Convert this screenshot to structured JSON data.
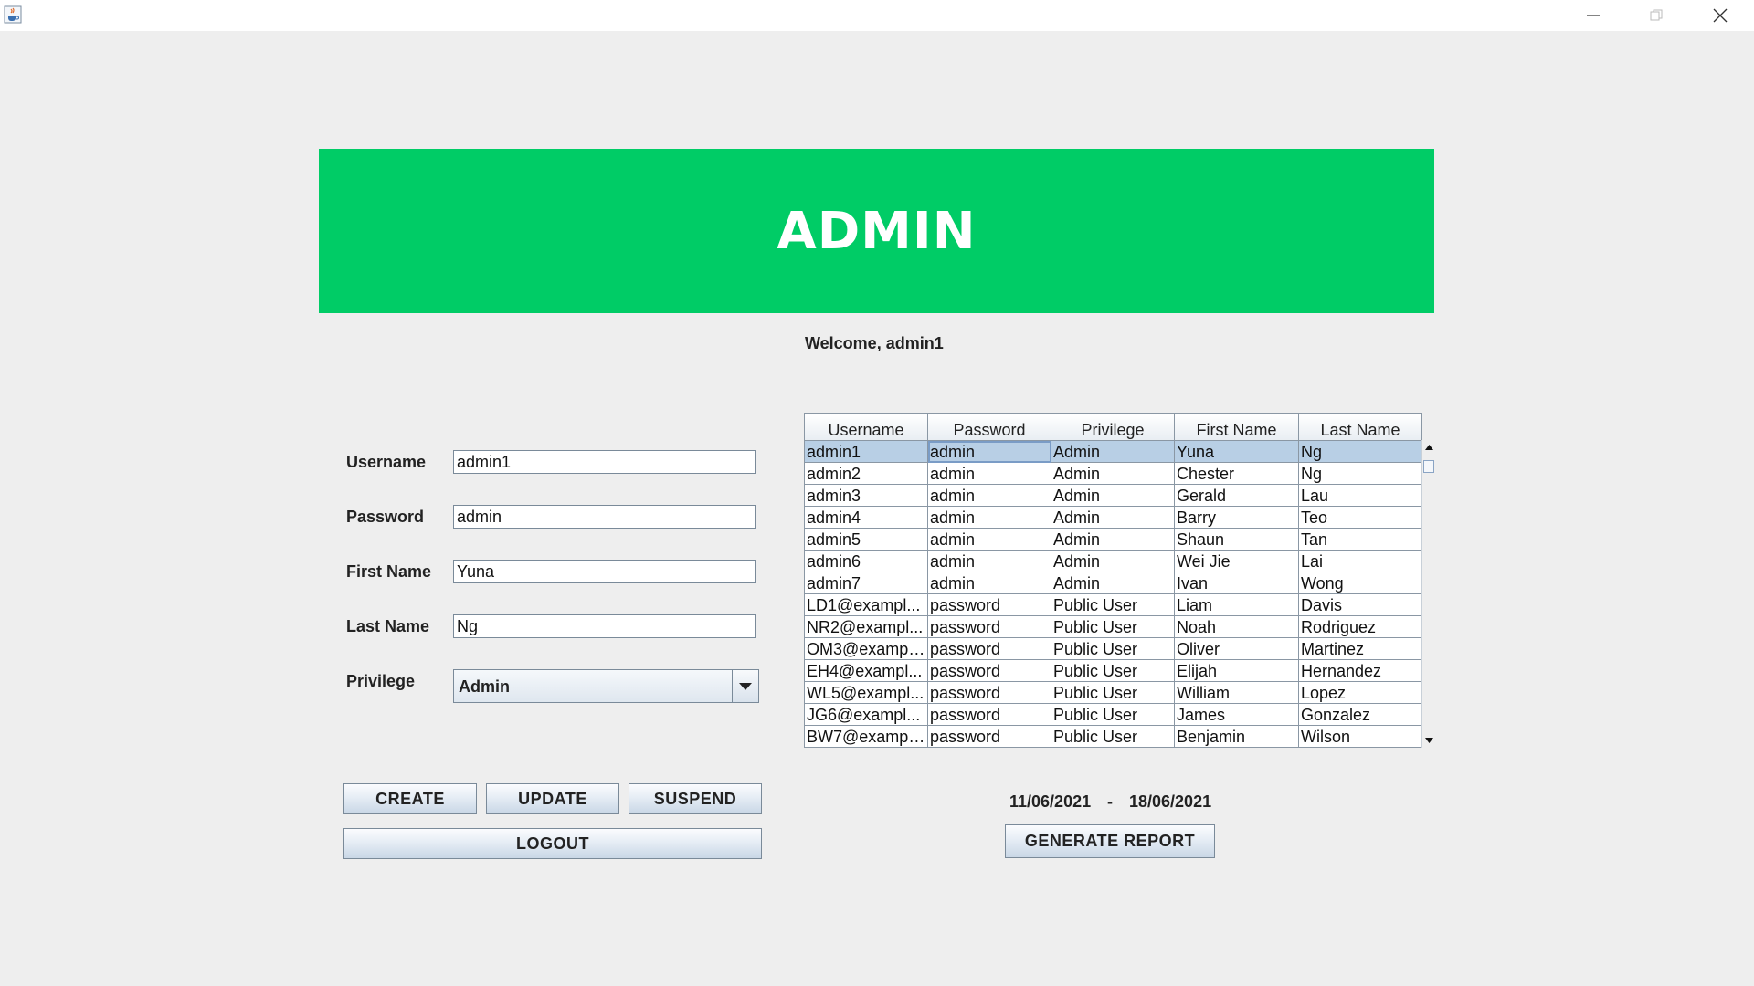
{
  "window": {
    "icon": "java-cup-icon",
    "controls": [
      "minimize-icon",
      "restore-icon",
      "close-icon"
    ]
  },
  "header": {
    "title": "ADMIN",
    "background": "#00cc66"
  },
  "welcome": "Welcome, admin1",
  "form": {
    "username_label": "Username",
    "username_value": "admin1",
    "password_label": "Password",
    "password_value": "admin",
    "first_name_label": "First Name",
    "first_name_value": "Yuna",
    "last_name_label": "Last Name",
    "last_name_value": "Ng",
    "privilege_label": "Privilege",
    "privilege_value": "Admin"
  },
  "buttons": {
    "create": "CREATE",
    "update": "UPDATE",
    "suspend": "SUSPEND",
    "logout": "LOGOUT",
    "generate_report": "GENERATE REPORT"
  },
  "table": {
    "columns": [
      "Username",
      "Password",
      "Privilege",
      "First Name",
      "Last Name"
    ],
    "rows": [
      [
        "admin1",
        "admin",
        "Admin",
        "Yuna",
        "Ng"
      ],
      [
        "admin2",
        "admin",
        "Admin",
        "Chester",
        "Ng"
      ],
      [
        "admin3",
        "admin",
        "Admin",
        "Gerald",
        "Lau"
      ],
      [
        "admin4",
        "admin",
        "Admin",
        "Barry",
        "Teo"
      ],
      [
        "admin5",
        "admin",
        "Admin",
        "Shaun",
        "Tan"
      ],
      [
        "admin6",
        "admin",
        "Admin",
        "Wei Jie",
        "Lai"
      ],
      [
        "admin7",
        "admin",
        "Admin",
        "Ivan",
        "Wong"
      ],
      [
        "LD1@exampl...",
        "password",
        "Public User",
        "Liam",
        "Davis"
      ],
      [
        "NR2@exampl...",
        "password",
        "Public User",
        "Noah",
        "Rodriguez"
      ],
      [
        "OM3@exampl...",
        "password",
        "Public User",
        "Oliver",
        "Martinez"
      ],
      [
        "EH4@exampl...",
        "password",
        "Public User",
        "Elijah",
        "Hernandez"
      ],
      [
        "WL5@exampl...",
        "password",
        "Public User",
        "William",
        "Lopez"
      ],
      [
        "JG6@exampl...",
        "password",
        "Public User",
        "James",
        "Gonzalez"
      ],
      [
        "BW7@exampl...",
        "password",
        "Public User",
        "Benjamin",
        "Wilson"
      ]
    ],
    "selected_row": 0
  },
  "report": {
    "start_date": "11/06/2021",
    "separator": "-",
    "end_date": "18/06/2021"
  }
}
